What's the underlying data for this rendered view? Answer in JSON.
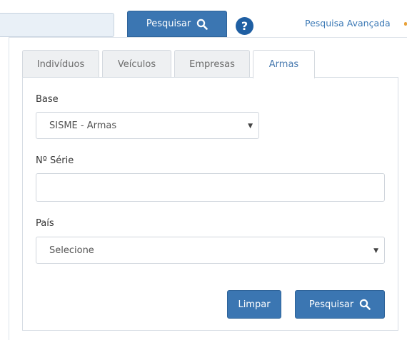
{
  "topbar": {
    "search_label": "Pesquisar",
    "help_label": "?",
    "advanced_label": "Pesquisa Avançada"
  },
  "tabs": [
    {
      "label": "Indivíduos"
    },
    {
      "label": "Veículos"
    },
    {
      "label": "Empresas"
    },
    {
      "label": "Armas",
      "active": true
    }
  ],
  "form": {
    "base_label": "Base",
    "base_value": "SISME - Armas",
    "serie_label": "Nº Série",
    "serie_value": "",
    "pais_label": "País",
    "pais_value": "Selecione"
  },
  "buttons": {
    "clear_label": "Limpar",
    "search_label": "Pesquisar"
  },
  "colors": {
    "primary": "#3b76b2",
    "link": "#3a78b5",
    "help": "#1f5fa3"
  }
}
